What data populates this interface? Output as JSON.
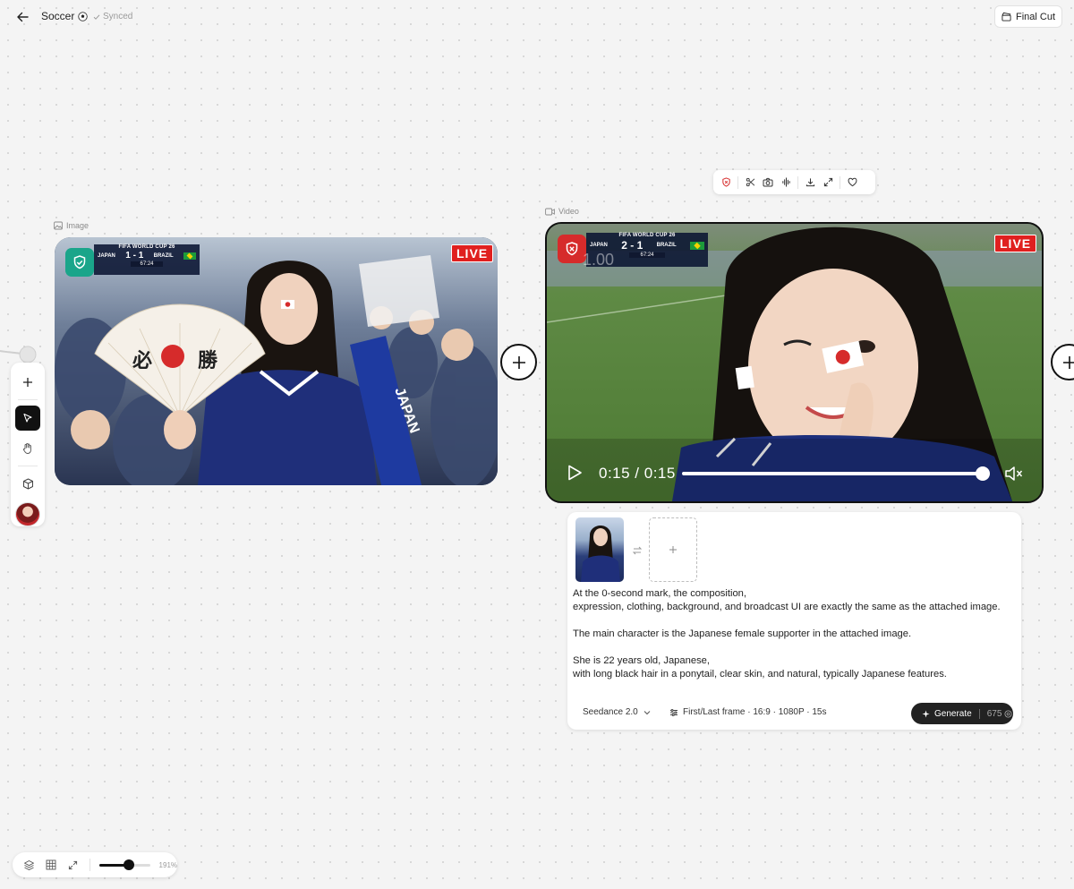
{
  "header": {
    "back_label": "Back",
    "title": "Soccer",
    "synced_label": "Synced",
    "final_cut_label": "Final Cut"
  },
  "media_toolbar": {
    "icons": [
      "shield-x-icon",
      "scissors-icon",
      "camera-icon",
      "audio-wave-icon",
      "download-icon",
      "expand-icon",
      "heart-icon"
    ]
  },
  "image_node": {
    "label": "Image",
    "scoreboard": {
      "title": "FIFA WORLD CUP 26",
      "home": "JAPAN",
      "away": "BRAZIL",
      "score": "1 - 1",
      "clock": "67:24"
    },
    "live_label": "LIVE",
    "fan_text_left": "必",
    "fan_text_right": "勝",
    "shield_color": "#1aa58a"
  },
  "video_node": {
    "label": "Video",
    "scoreboard": {
      "title": "FIFA WORLD CUP 26",
      "home": "JAPAN",
      "away": "BRAZIL",
      "score": "2 - 1",
      "clock": "67:24",
      "overlay_value": "1.00"
    },
    "live_label": "LIVE",
    "shield_color": "#d62b2b",
    "time_display": "0:15 / 0:15",
    "progress": 1.0
  },
  "prompt_panel": {
    "lines": [
      "At the 0-second mark, the composition,",
      "expression, clothing, background, and broadcast UI are exactly the same as the attached image.",
      "",
      "The main character is the Japanese female supporter in the attached image.",
      "",
      "She is 22 years old, Japanese,",
      "with long black hair in a ponytail, clear skin, and natural, typically Japanese features."
    ],
    "model": "Seedance 2.0",
    "settings": "First/Last frame · 16:9 · 1080P · 15s",
    "generate_label": "Generate",
    "credits": "675"
  },
  "bottom_bar": {
    "zoom_label": "191%",
    "zoom_fraction": 0.58
  },
  "colors": {
    "accent_dark": "#111111",
    "live_red": "#e0201f",
    "canvas_bg": "#f4f4f4"
  }
}
